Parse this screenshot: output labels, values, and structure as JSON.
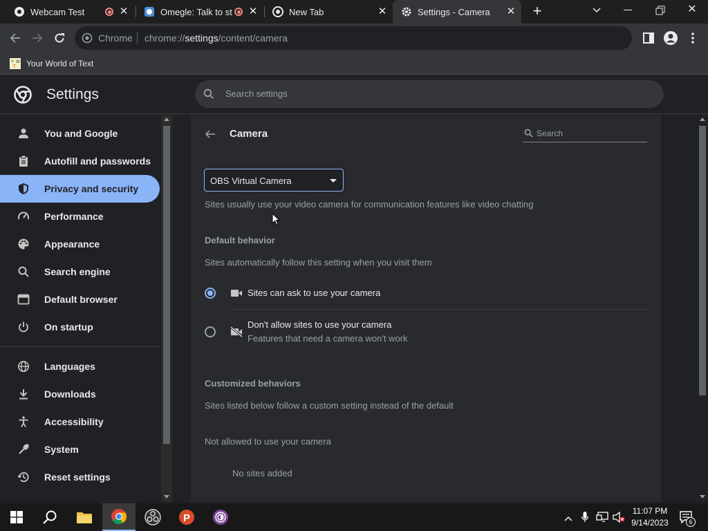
{
  "tabs": [
    {
      "title": "Webcam Test",
      "recording": true
    },
    {
      "title": "Omegle: Talk to str",
      "recording": true
    },
    {
      "title": "New Tab",
      "recording": false
    },
    {
      "title": "Settings - Camera",
      "recording": false,
      "active": true
    }
  ],
  "toolbar": {
    "url_scheme_label": "Chrome",
    "url_host": "chrome://",
    "url_bold": "settings",
    "url_path": "/content/camera"
  },
  "bookmarks": [
    {
      "label": "Your World of Text"
    }
  ],
  "settings": {
    "title": "Settings",
    "search_placeholder": "Search settings"
  },
  "sidebar": {
    "items": [
      {
        "label": "You and Google",
        "icon": "person-icon"
      },
      {
        "label": "Autofill and passwords",
        "icon": "clipboard-icon"
      },
      {
        "label": "Privacy and security",
        "icon": "shield-icon",
        "selected": true
      },
      {
        "label": "Performance",
        "icon": "speedometer-icon"
      },
      {
        "label": "Appearance",
        "icon": "palette-icon"
      },
      {
        "label": "Search engine",
        "icon": "search-icon"
      },
      {
        "label": "Default browser",
        "icon": "browser-icon"
      },
      {
        "label": "On startup",
        "icon": "power-icon"
      },
      {
        "label": "Languages",
        "icon": "globe-icon"
      },
      {
        "label": "Downloads",
        "icon": "download-icon"
      },
      {
        "label": "Accessibility",
        "icon": "accessibility-icon"
      },
      {
        "label": "System",
        "icon": "wrench-icon"
      },
      {
        "label": "Reset settings",
        "icon": "history-icon"
      }
    ]
  },
  "camera": {
    "page_title": "Camera",
    "search_placeholder": "Search",
    "device_selected": "OBS Virtual Camera",
    "description": "Sites usually use your video camera for communication features like video chatting",
    "default_behavior_title": "Default behavior",
    "default_behavior_sub": "Sites automatically follow this setting when you visit them",
    "option_allow": "Sites can ask to use your camera",
    "option_block": "Don't allow sites to use your camera",
    "option_block_sub": "Features that need a camera won't work",
    "selected_option": "allow",
    "customized_title": "Customized behaviors",
    "customized_sub": "Sites listed below follow a custom setting instead of the default",
    "not_allowed_title": "Not allowed to use your camera",
    "no_sites": "No sites added"
  },
  "taskbar": {
    "time": "11:07 PM",
    "date": "9/14/2023",
    "notification_count": "6",
    "apps": [
      "windows-start-icon",
      "search-icon",
      "file-explorer-icon",
      "chrome-icon",
      "obs-icon",
      "pinterest-like-p-icon",
      "tor-browser-icon"
    ]
  },
  "colors": {
    "accent": "#8ab4f8",
    "background": "#202124",
    "card": "#292a2d",
    "toolbar": "#35363a"
  }
}
